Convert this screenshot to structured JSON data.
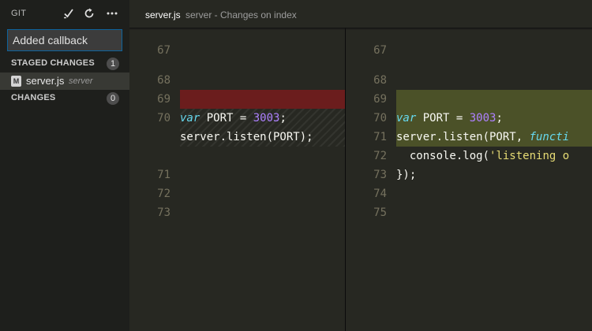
{
  "sidebar": {
    "title": "GIT",
    "icons": {
      "commit": "check-icon",
      "refresh": "refresh-icon",
      "more": "more-icon"
    },
    "commit_message": "Added callback",
    "staged": {
      "label": "STAGED CHANGES",
      "count": "1",
      "files": [
        {
          "status": "M",
          "name": "server.js",
          "dir": "server"
        }
      ]
    },
    "changes": {
      "label": "CHANGES",
      "count": "0"
    }
  },
  "editor": {
    "file": "server.js",
    "description": "server - Changes on index",
    "left": {
      "lines": [
        {
          "n": "67",
          "code": ""
        },
        {
          "n": "68",
          "code": ""
        },
        {
          "n": "69",
          "code": "var PORT = 3003;"
        },
        {
          "n": "70",
          "code": "server.listen(PORT);"
        },
        {
          "n": "71",
          "code": ""
        },
        {
          "n": "72",
          "code": ""
        },
        {
          "n": "73",
          "code": ""
        }
      ]
    },
    "right": {
      "lines": [
        {
          "n": "67",
          "code": ""
        },
        {
          "n": "68",
          "code": ""
        },
        {
          "n": "69",
          "code": "var PORT = 3003;"
        },
        {
          "n": "70",
          "code": "server.listen(PORT, functi"
        },
        {
          "n": "71",
          "code": "  console.log('listening o"
        },
        {
          "n": "72",
          "code": "});"
        },
        {
          "n": "73",
          "code": ""
        },
        {
          "n": "74",
          "code": ""
        },
        {
          "n": "75",
          "code": ""
        }
      ]
    },
    "tokens": {
      "var": "var",
      "port_assign": " PORT = ",
      "port_value": "3003",
      "semicolon": ";",
      "listen_left": "server.listen(PORT);",
      "listen_right_head": "server.listen(PORT, ",
      "function_kw": "functi",
      "console_head": "  console.log(",
      "console_str": "'listening o",
      "close": "});"
    },
    "colors": {
      "deleted": "#6b1d1d",
      "inserted": "#4b5128",
      "keyword": "#66d9ef",
      "number": "#ae81ff",
      "string": "#e6db74"
    }
  }
}
